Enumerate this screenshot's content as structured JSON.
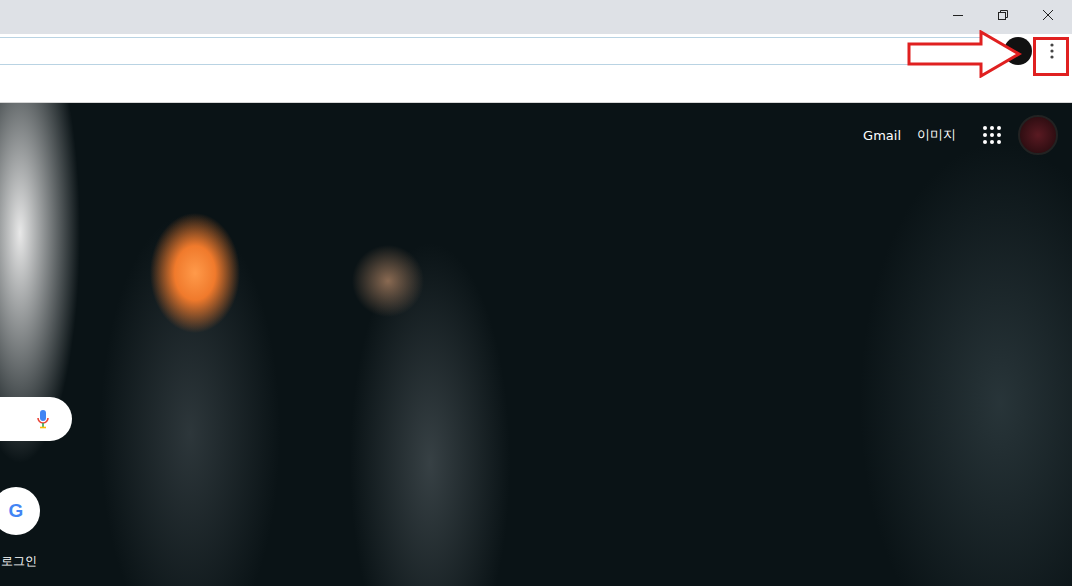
{
  "window": {
    "controls": [
      "minimize",
      "restore",
      "close"
    ]
  },
  "toolbar": {
    "bookmark_star": true,
    "profile_avatar": true,
    "menu_button": true
  },
  "annotation": {
    "arrow": true,
    "highlight_box": true
  },
  "new_tab": {
    "links": [
      "Gmail",
      "이미지"
    ],
    "apps_button": true,
    "account_avatar": true,
    "search_box": {
      "mic": true
    },
    "shortcuts": [
      {
        "label": "로그인",
        "icon": "G"
      }
    ]
  }
}
